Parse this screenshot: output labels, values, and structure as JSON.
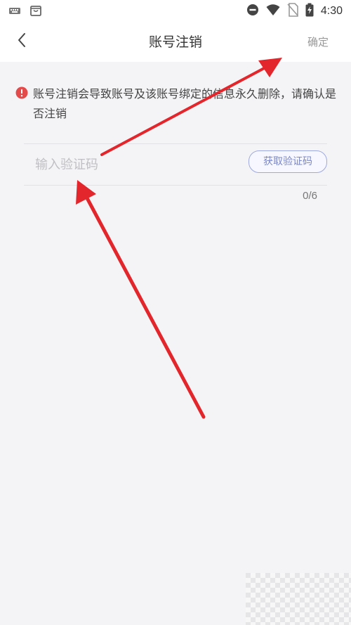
{
  "status_bar": {
    "time": "4:30",
    "left_icons": [
      "keyboard-icon",
      "bag-icon"
    ],
    "right_icons": [
      "do-not-disturb-icon",
      "wifi-icon",
      "no-sim-icon",
      "battery-charging-icon"
    ]
  },
  "header": {
    "back_icon": "chevron-left-icon",
    "title": "账号注销",
    "confirm_label": "确定"
  },
  "warning": {
    "icon": "alert-circle-icon",
    "color": "#e34b4b",
    "text": "账号注销会导致账号及该账号绑定的信息永久删除，请确认是否注销"
  },
  "verification": {
    "placeholder": "输入验证码",
    "value": "",
    "get_code_label": "获取验证码",
    "counter": "0/6"
  },
  "colors": {
    "background": "#f4f4f7",
    "header_bg": "#ffffff",
    "accent": "#7c88c8",
    "annotation_arrow": "#e3262b"
  }
}
